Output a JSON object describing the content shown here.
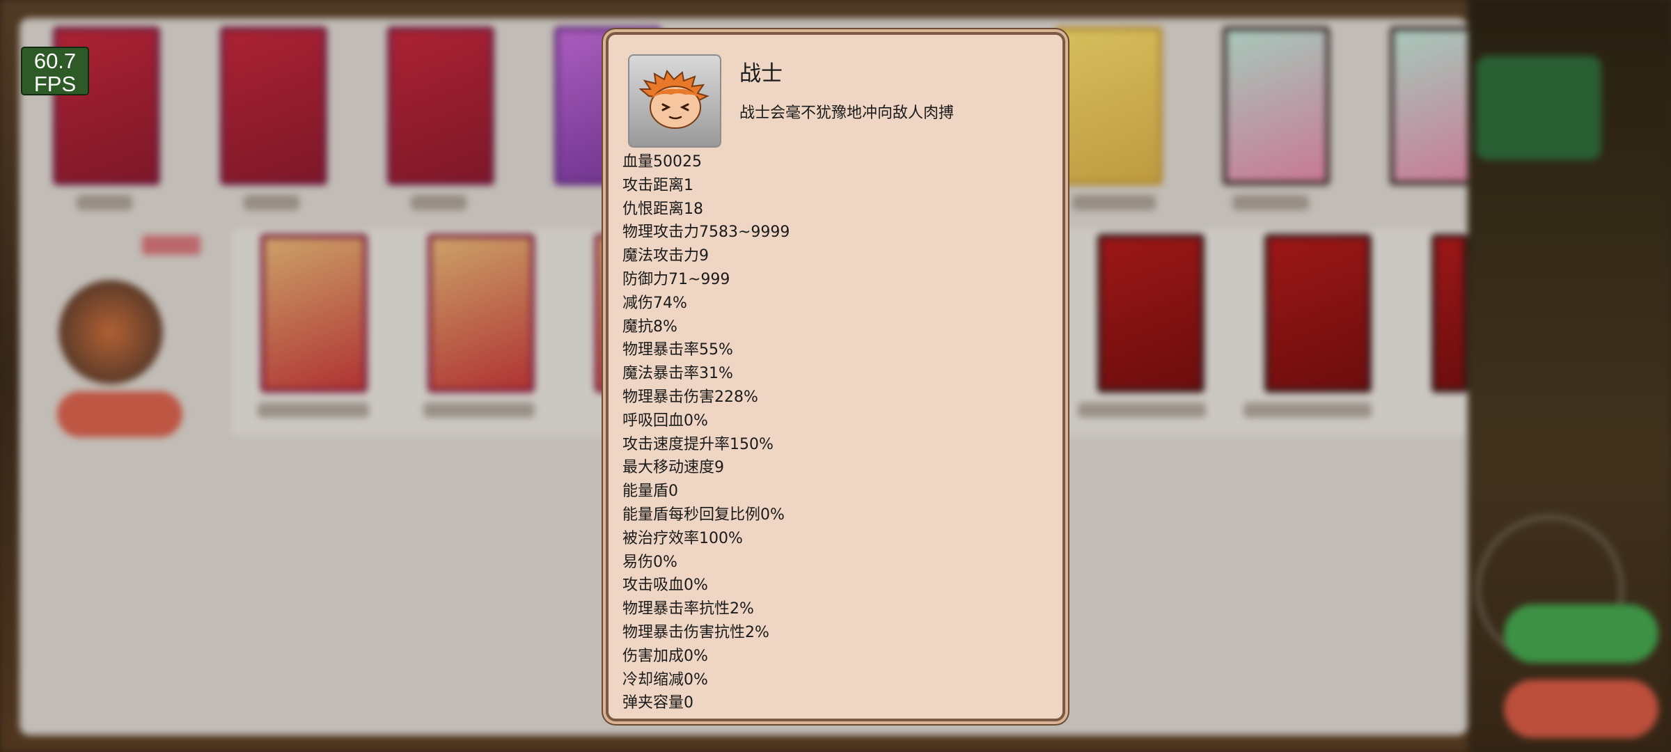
{
  "fps": {
    "value": "60.7",
    "unit": "FPS"
  },
  "modal": {
    "title": "战士",
    "description": "战士会毫不犹豫地冲向敌人肉搏",
    "stats": [
      "血量50025",
      "攻击距离1",
      "仇恨距离18",
      "物理攻击力7583~9999",
      "魔法攻击力9",
      "防御力71~999",
      "减伤74%",
      "魔抗8%",
      "物理暴击率55%",
      "魔法暴击率31%",
      "物理暴击伤害228%",
      "呼吸回血0%",
      "攻击速度提升率150%",
      "最大移动速度9",
      "能量盾0",
      "能量盾每秒回复比例0%",
      "被治疗效率100%",
      "易伤0%",
      "攻击吸血0%",
      "物理暴击率抗性2%",
      "物理暴击伤害抗性2%",
      "伤害加成0%",
      "冷却缩减0%",
      "弹夹容量0"
    ]
  },
  "colors": {
    "modal_bg": "#efd6c4",
    "modal_border": "#7a5a45",
    "fps_bg": "#2d5a26"
  },
  "icons": {
    "avatar": "warrior-head-icon"
  }
}
